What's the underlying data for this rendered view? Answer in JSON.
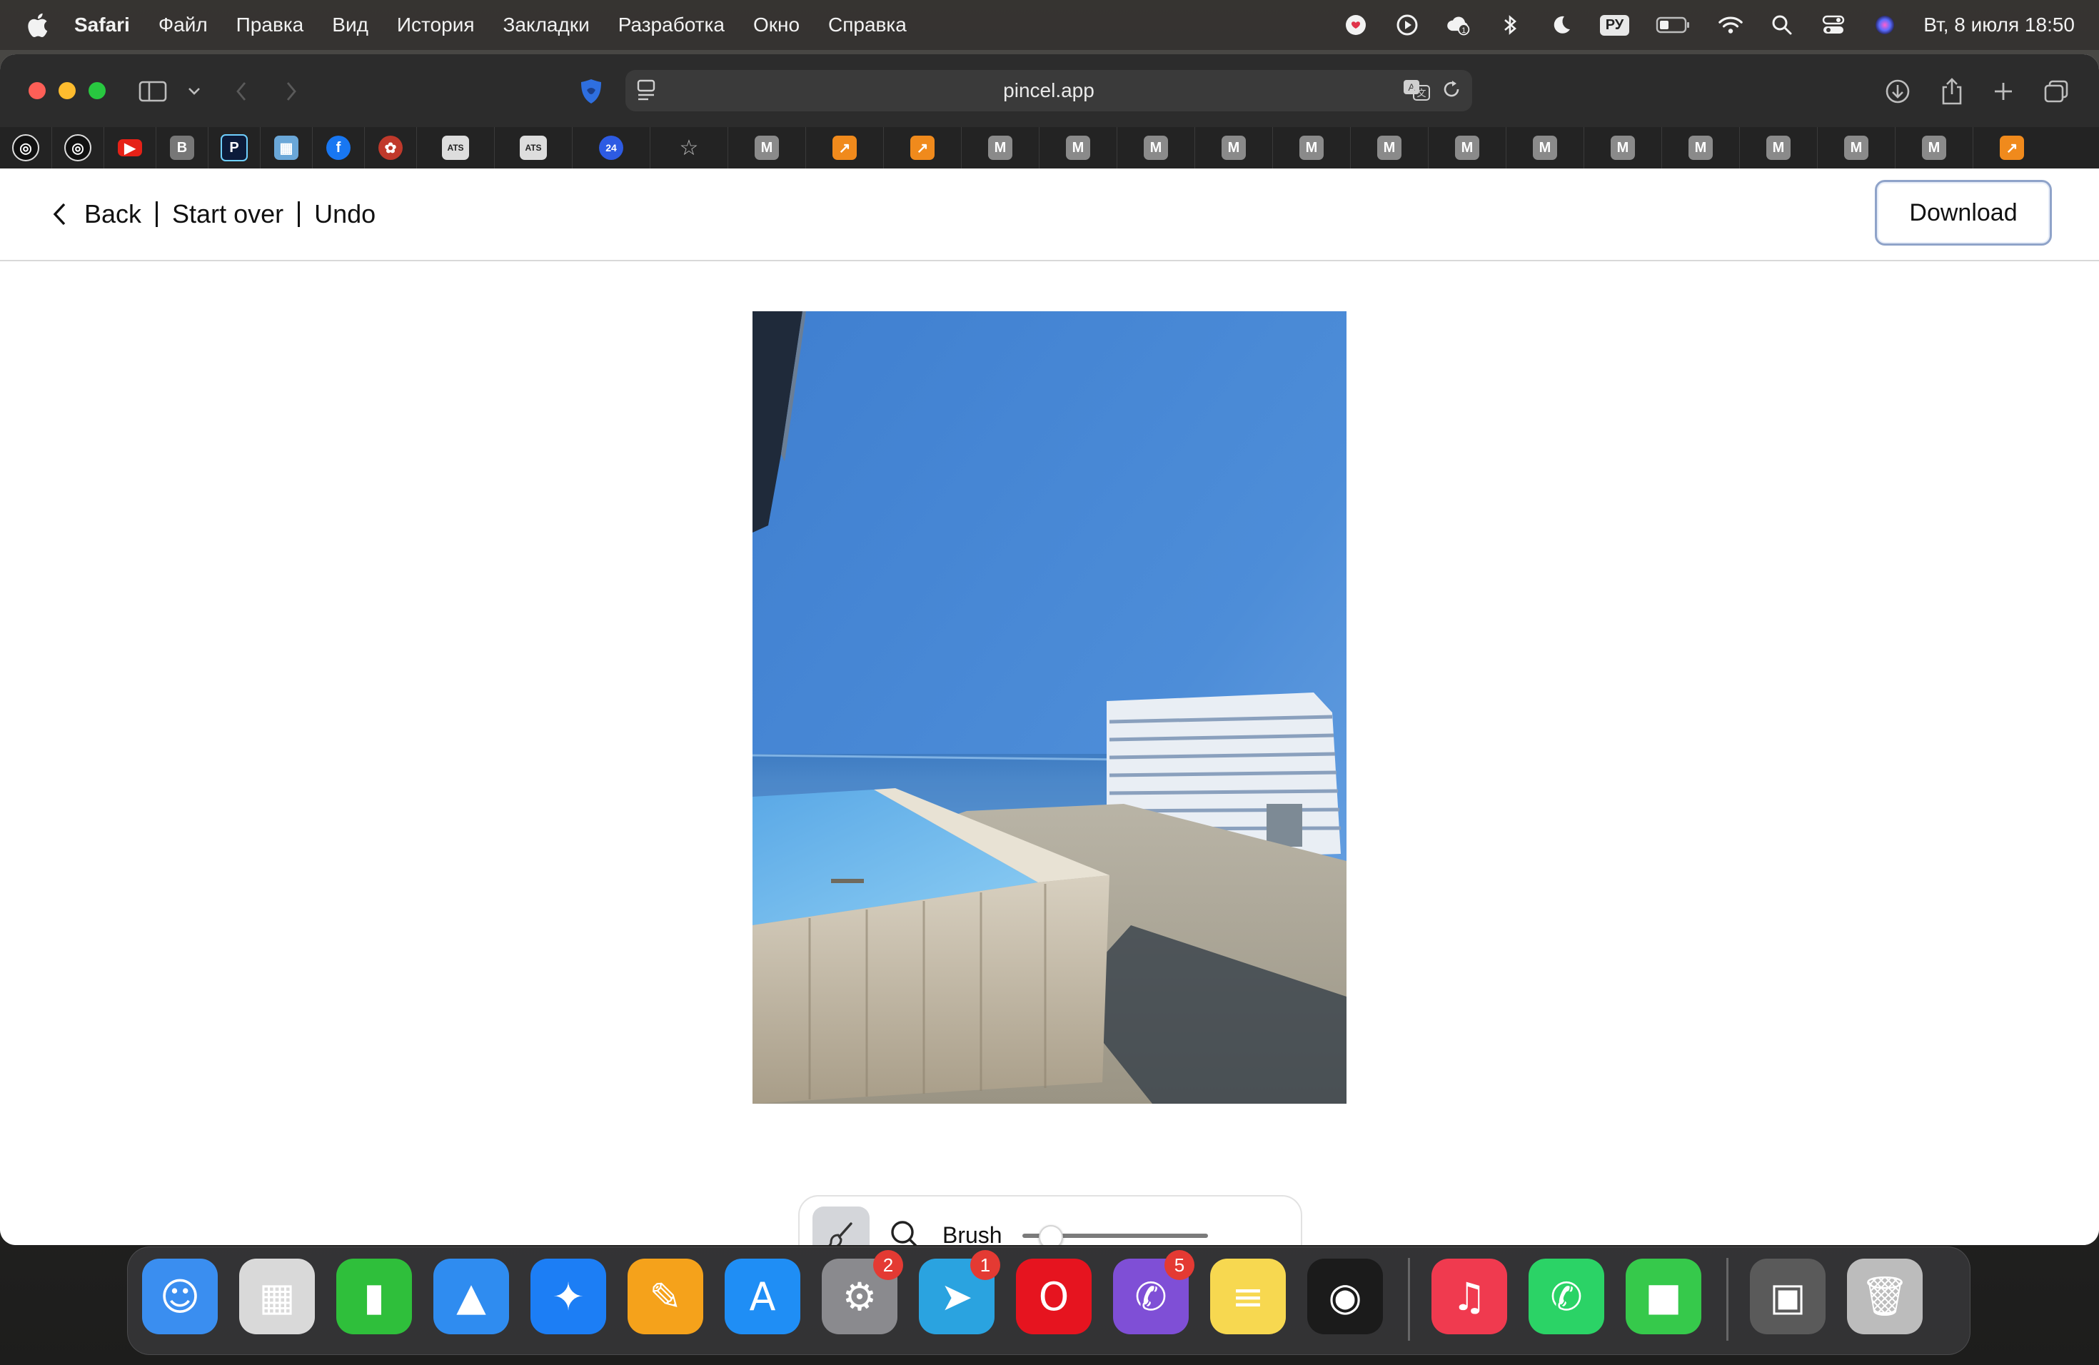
{
  "menubar": {
    "app": "Safari",
    "items": [
      "Файл",
      "Правка",
      "Вид",
      "История",
      "Закладки",
      "Разработка",
      "Окно",
      "Справка"
    ],
    "input_source": "РУ",
    "clock": "Вт, 8 июля  18:50",
    "status_icons": [
      "notification-app-icon",
      "play-icon",
      "cloud-icon",
      "bluetooth-icon",
      "moon-icon",
      "input-source-icon",
      "battery-icon",
      "wifi-icon",
      "search-icon",
      "control-center-icon",
      "siri-icon"
    ]
  },
  "browser": {
    "address": "pincel.app",
    "bookmarks": [
      "openai",
      "openai",
      "youtube",
      "B",
      "P",
      "photo",
      "facebook",
      "app",
      "ATS",
      "ATS",
      "24",
      "star",
      "M",
      "arrow",
      "arrow",
      "M",
      "M",
      "M",
      "M",
      "M",
      "M",
      "M",
      "M",
      "M",
      "M",
      "M",
      "M",
      "M",
      "M",
      "arrow"
    ]
  },
  "page": {
    "back_label": "Back",
    "start_over_label": "Start over",
    "undo_label": "Undo",
    "download_label": "Download",
    "tools": {
      "brush_label": "Brush",
      "brush_size": 0.1
    }
  },
  "dock": {
    "apps": [
      {
        "name": "Finder",
        "color": "#3a8ef0"
      },
      {
        "name": "Launchpad",
        "color": "#d9d9d9"
      },
      {
        "name": "Numbers",
        "color": "#2fbf3b"
      },
      {
        "name": "Keynote",
        "color": "#2f8cf0"
      },
      {
        "name": "Safari",
        "color": "#1c7ef5"
      },
      {
        "name": "Pages",
        "color": "#f5a21b"
      },
      {
        "name": "App Store",
        "color": "#1f8ef5"
      },
      {
        "name": "System Settings",
        "color": "#8a8a8e",
        "badge": "2"
      },
      {
        "name": "Telegram",
        "color": "#2aa3e0",
        "badge": "1"
      },
      {
        "name": "Opera",
        "color": "#e6141f"
      },
      {
        "name": "Viber",
        "color": "#7f4fd6",
        "badge": "5"
      },
      {
        "name": "Notes",
        "color": "#f7d850"
      },
      {
        "name": "Camo",
        "color": "#1b1b1b"
      },
      {
        "name": "Music",
        "color": "#f03a4f"
      },
      {
        "name": "WhatsApp",
        "color": "#2bd366"
      },
      {
        "name": "FaceTime",
        "color": "#36c94b"
      },
      {
        "name": "Photos stack",
        "color": "#5a5a5a"
      },
      {
        "name": "Trash",
        "color": "#bcbcbc"
      }
    ]
  }
}
